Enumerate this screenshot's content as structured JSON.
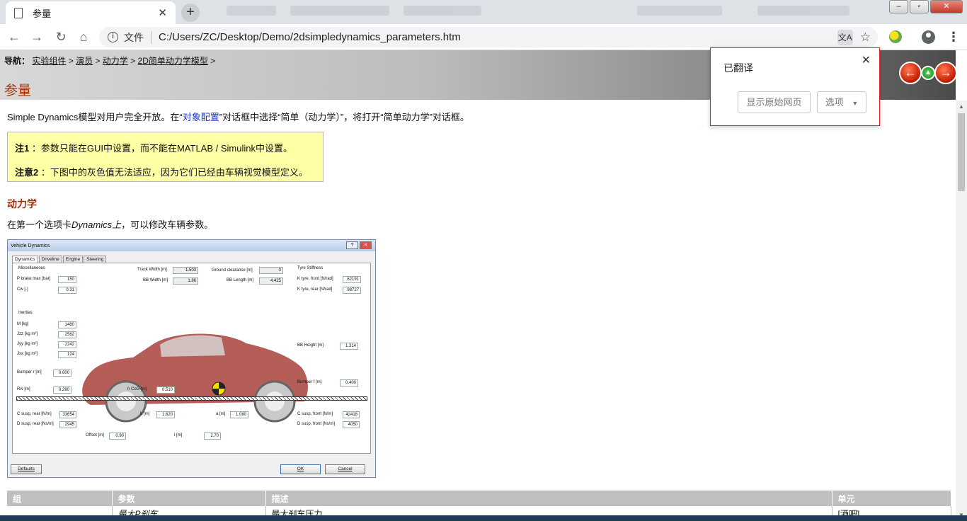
{
  "browser": {
    "tab_title": "参量",
    "url_prefix": "文件",
    "url": "C:/Users/ZC/Desktop/Demo/2dsimpledynamics_parameters.htm"
  },
  "page": {
    "breadcrumb_label": "导航：",
    "breadcrumb": [
      "实验组件",
      "演员",
      "动力学",
      "2D简单动力学模型"
    ],
    "breadcrumb_sep": ">",
    "title": "参量",
    "intro_before": "Simple Dynamics模型对用户完全开放。在“",
    "intro_link": "对象配置",
    "intro_after": "”对话框中选择“简单（动力学）”，将打开“简单动力学”对话框。",
    "notes": [
      {
        "label": "注1",
        "text": "：参数只能在GUI中设置，而不能在MATLAB / Simulink中设置。"
      },
      {
        "label": "注意2",
        "text": "：下图中的灰色值无法适应，因为它们已经由车辆视觉模型定义。"
      }
    ],
    "section_heading": "动力学",
    "section_intro_before": "在第一个选项卡",
    "section_intro_italic": "Dynamics上",
    "section_intro_after": "，可以修改车辆参数。"
  },
  "dialog": {
    "title": "Vehicle Dynamics",
    "tabs": [
      "Dynamics",
      "Driveline",
      "Engine",
      "Steering"
    ],
    "groups": {
      "misc": "Miscellaneous",
      "tyre": "Tyre Stiffness",
      "inertias": "Inertias"
    },
    "fields": {
      "p_brake": {
        "label": "P brake max [bar]",
        "value": "150"
      },
      "cw": {
        "label": "Cw [-]",
        "value": "0.31"
      },
      "track_width": {
        "label": "Track Width [m]",
        "value": "1.503"
      },
      "bb_width": {
        "label": "BB Width [m]",
        "value": "1.86"
      },
      "ground_clearance": {
        "label": "Ground clearance [m]",
        "value": "0"
      },
      "bb_length": {
        "label": "BB Length [m]",
        "value": "4.425"
      },
      "k_front": {
        "label": "K tyre, front  [N/rad]",
        "value": "62191"
      },
      "k_rear": {
        "label": "K tyre, rear  [N/rad]",
        "value": "98727"
      },
      "m": {
        "label": "M [kg]",
        "value": "1480"
      },
      "jzz": {
        "label": "Jzz [kg m²]",
        "value": "2562"
      },
      "jyy": {
        "label": "Jyy [kg m²]",
        "value": "2242"
      },
      "jxx": {
        "label": "Jxx [kg m²]",
        "value": "124"
      },
      "bb_height": {
        "label": "BB Height [m]",
        "value": "1.314"
      },
      "bumper_r": {
        "label": "Bumper r [m]",
        "value": "0.600"
      },
      "rw": {
        "label": "Rw [m]",
        "value": "0.290"
      },
      "h_cog": {
        "label": "h CoG [m]",
        "value": "0.510"
      },
      "bumper_f": {
        "label": "Bumper f [m]",
        "value": "0.400"
      },
      "c_susp_rear": {
        "label": "C susp, rear  [N/m]",
        "value": "33654"
      },
      "d_susp_rear": {
        "label": "D susp, rear [Ns/m]",
        "value": "2945"
      },
      "b": {
        "label": "b [m]",
        "value": "1.620"
      },
      "a": {
        "label": "a [m]",
        "value": "1.080"
      },
      "c_susp_front": {
        "label": "C susp, front [N/m]",
        "value": "42418"
      },
      "d_susp_front": {
        "label": "D susp, front [Ns/m]",
        "value": "4050"
      },
      "offset": {
        "label": "Offset [m]",
        "value": "0.90"
      },
      "l": {
        "label": "l [m]",
        "value": "2.70"
      }
    },
    "buttons": {
      "defaults": "Defaults",
      "ok": "OK",
      "cancel": "Cancel"
    }
  },
  "table": {
    "headers": [
      "组",
      "参数",
      "描述",
      "单元"
    ],
    "rows": [
      [
        "",
        "最大P刹车",
        "最大刹车压力",
        "[酒吧]"
      ]
    ]
  },
  "translate_bubble": {
    "title": "已翻译",
    "show_original": "显示原始网页",
    "options": "选项"
  }
}
